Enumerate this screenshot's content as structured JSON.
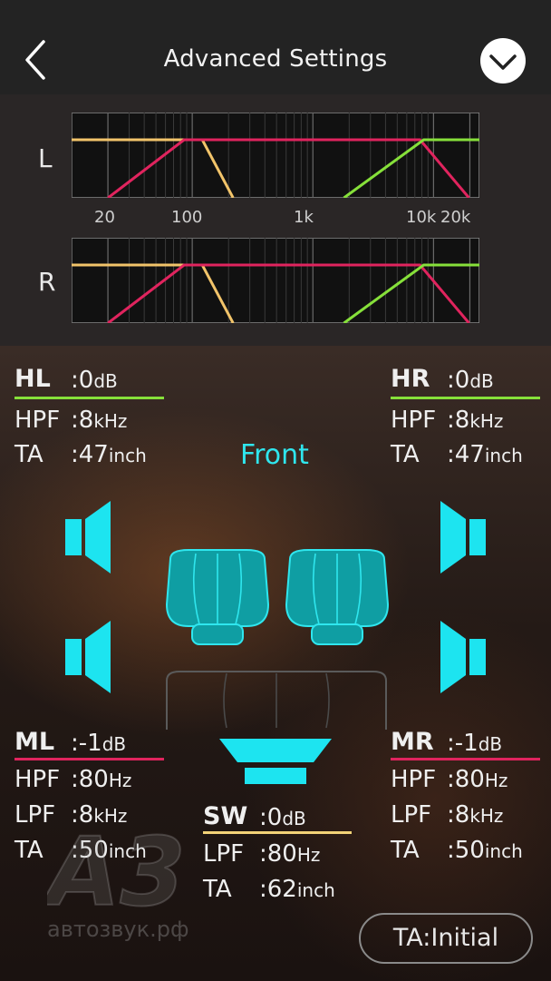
{
  "header": {
    "title": "Advanced Settings",
    "back_icon": "chevron-left-icon",
    "confirm_icon": "chevron-down-circle-icon"
  },
  "crossover_graph": {
    "left_label": "L",
    "right_label": "R",
    "freq_labels": [
      "20",
      "100",
      "1k",
      "10k",
      "20k"
    ],
    "curve_colors": {
      "sw": "#f2c46a",
      "mid": "#e0245e",
      "high": "#86e03a"
    }
  },
  "channels": {
    "HL": {
      "name": "HL",
      "level": "0",
      "level_unit": "dB",
      "hpf_label": "HPF",
      "hpf_value": "8",
      "hpf_unit": "kHz",
      "ta_label": "TA",
      "ta_value": "47",
      "ta_unit": "inch",
      "color": "#86e03a"
    },
    "HR": {
      "name": "HR",
      "level": "0",
      "level_unit": "dB",
      "hpf_label": "HPF",
      "hpf_value": "8",
      "hpf_unit": "kHz",
      "ta_label": "TA",
      "ta_value": "47",
      "ta_unit": "inch",
      "color": "#86e03a"
    },
    "ML": {
      "name": "ML",
      "level": "-1",
      "level_unit": "dB",
      "hpf_label": "HPF",
      "hpf_value": "80",
      "hpf_unit": "Hz",
      "lpf_label": "LPF",
      "lpf_value": "8",
      "lpf_unit": "kHz",
      "ta_label": "TA",
      "ta_value": "50",
      "ta_unit": "inch",
      "color": "#e0245e"
    },
    "MR": {
      "name": "MR",
      "level": "-1",
      "level_unit": "dB",
      "hpf_label": "HPF",
      "hpf_value": "80",
      "hpf_unit": "Hz",
      "lpf_label": "LPF",
      "lpf_value": "8",
      "lpf_unit": "kHz",
      "ta_label": "TA",
      "ta_value": "50",
      "ta_unit": "inch",
      "color": "#e0245e"
    },
    "SW": {
      "name": "SW",
      "level": "0",
      "level_unit": "dB",
      "lpf_label": "LPF",
      "lpf_value": "80",
      "lpf_unit": "Hz",
      "ta_label": "TA",
      "ta_value": "62",
      "ta_unit": "inch",
      "color": "#f2d277"
    }
  },
  "colon": ":",
  "front_label": "Front",
  "ta_initial_button": "TA:Initial",
  "accent_color": "#2fe6ee",
  "watermark": {
    "logo_text": "A3",
    "text": "автозвук.рф"
  }
}
